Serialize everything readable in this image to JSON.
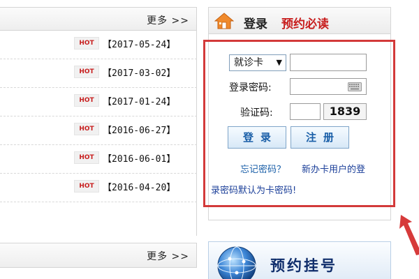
{
  "news_panel": {
    "more_label": "更多 >>",
    "items": [
      {
        "badge": "HOT",
        "date": "【2017-05-24】"
      },
      {
        "badge": "HOT",
        "date": "【2017-03-02】"
      },
      {
        "badge": "HOT",
        "date": "【2017-01-24】"
      },
      {
        "badge": "HOT",
        "date": "【2016-06-27】"
      },
      {
        "badge": "HOT",
        "date": "【2016-06-01】"
      },
      {
        "badge": "HOT",
        "date": "【2016-04-20】"
      }
    ],
    "more_label_2": "更多 >>"
  },
  "login": {
    "title": "登录",
    "notice_link": "预约必读",
    "card_type": "就诊卡",
    "card_type_arrow": "▼",
    "password_label": "登录密码:",
    "captcha_label": "验证码:",
    "captcha_code": "1839",
    "login_button": "登录",
    "register_button": "注册",
    "forgot_password": "忘记密码？",
    "help_line_1": "新办卡用户的登",
    "help_line_2": "录密码默认为卡密码!"
  },
  "banner": {
    "label": "预约挂号"
  },
  "colors": {
    "accent_red": "#d33a3a",
    "link_blue": "#1a5fa8",
    "hot_red": "#c81e1e"
  },
  "icons": {
    "house": "house-icon",
    "keyboard": "keyboard-icon",
    "globe": "globe-icon",
    "arrow": "red-arrow-icon"
  }
}
